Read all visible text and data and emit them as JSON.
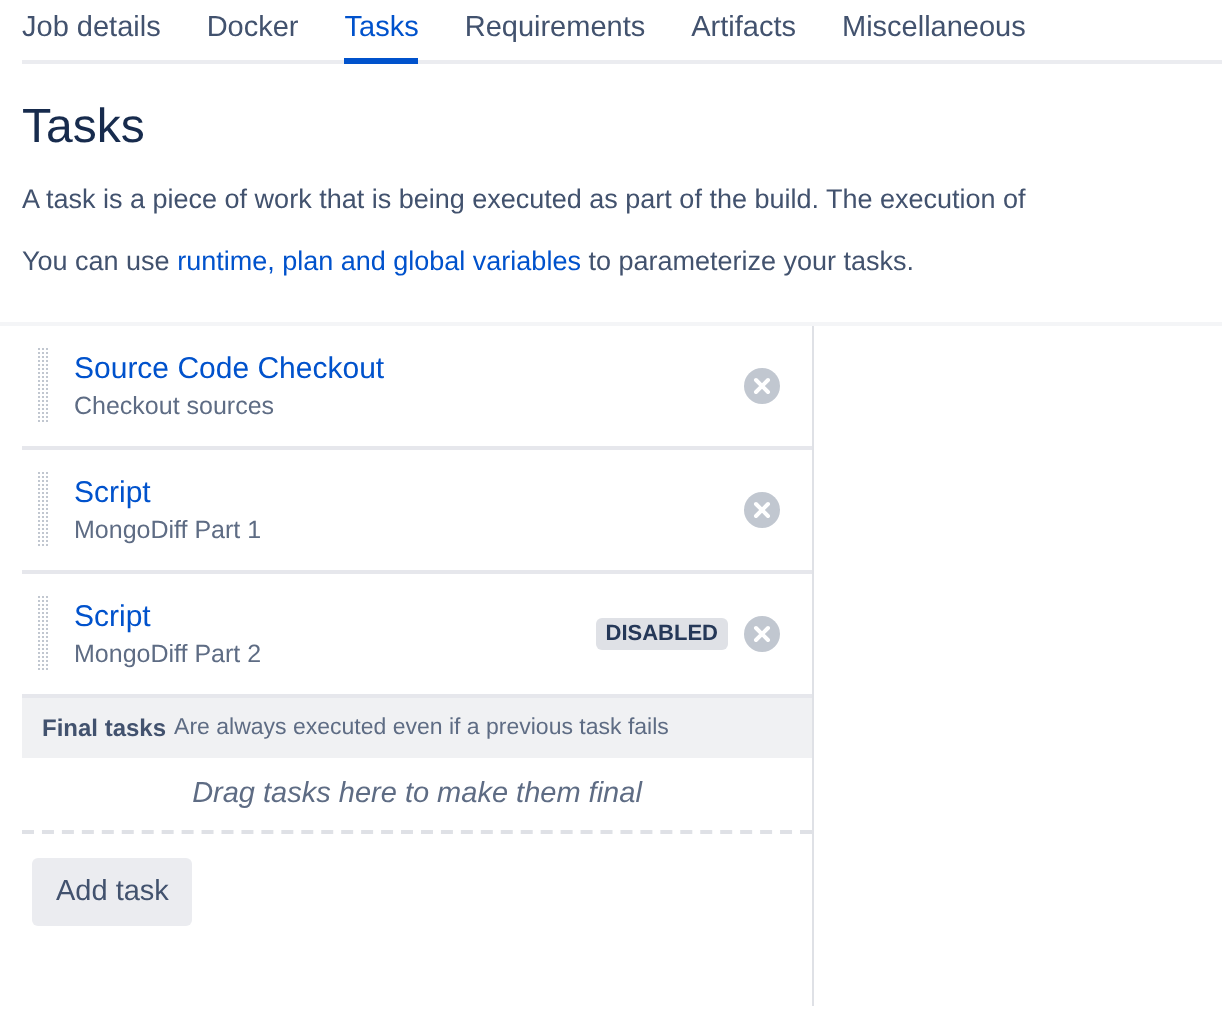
{
  "tabs": [
    {
      "label": "Job details",
      "selected": false
    },
    {
      "label": "Docker",
      "selected": false
    },
    {
      "label": "Tasks",
      "selected": true
    },
    {
      "label": "Requirements",
      "selected": false
    },
    {
      "label": "Artifacts",
      "selected": false
    },
    {
      "label": "Miscellaneous",
      "selected": false
    }
  ],
  "title": "Tasks",
  "description": "A task is a piece of work that is being executed as part of the build. The execution of",
  "variables_note": {
    "before": "You can use ",
    "link": "runtime, plan and global variables",
    "after": " to parameterize your tasks."
  },
  "tasks": [
    {
      "name": "Source Code Checkout",
      "description": "Checkout sources"
    },
    {
      "name": "Script",
      "description": "MongoDiff Part 1"
    },
    {
      "name": "Script",
      "description": "MongoDiff Part 2",
      "badge": "DISABLED"
    }
  ],
  "final_tasks": {
    "label": "Final tasks",
    "hint": "Are always executed even if a previous task fails",
    "drop_text": "Drag tasks here to make them final"
  },
  "add_button": "Add task"
}
